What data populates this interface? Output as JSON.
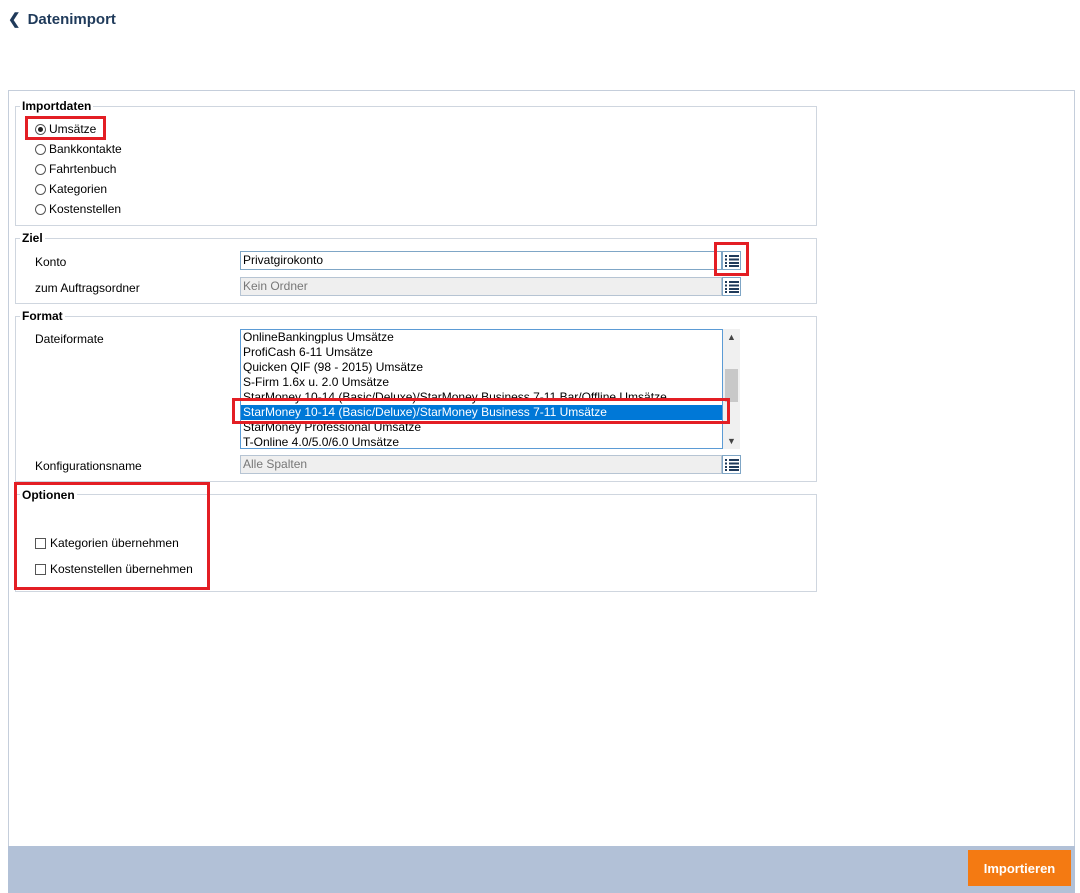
{
  "header": {
    "title": "Datenimport"
  },
  "importdaten": {
    "legend": "Importdaten",
    "options": [
      {
        "label": "Umsätze",
        "checked": true
      },
      {
        "label": "Bankkontakte",
        "checked": false
      },
      {
        "label": "Fahrtenbuch",
        "checked": false
      },
      {
        "label": "Kategorien",
        "checked": false
      },
      {
        "label": "Kostenstellen",
        "checked": false
      }
    ]
  },
  "ziel": {
    "legend": "Ziel",
    "konto_label": "Konto",
    "konto_value": "Privatgirokonto",
    "auftragsordner_label": "zum Auftragsordner",
    "auftragsordner_placeholder": "Kein Ordner"
  },
  "format": {
    "legend": "Format",
    "dateiformate_label": "Dateiformate",
    "items": [
      "OnlineBankingplus Umsätze",
      "ProfiCash 6-11 Umsätze",
      "Quicken QIF (98 - 2015) Umsätze",
      "S-Firm 1.6x u. 2.0 Umsätze",
      "StarMoney 10-14 (Basic/Deluxe)/StarMoney Business 7-11 Bar/Offline Umsätze",
      "StarMoney 10-14 (Basic/Deluxe)/StarMoney Business 7-11 Umsätze",
      "StarMoney Professional Umsätze",
      "T-Online 4.0/5.0/6.0 Umsätze"
    ],
    "selected_index": 5,
    "konfigurationsname_label": "Konfigurationsname",
    "konfigurationsname_placeholder": "Alle Spalten"
  },
  "optionen": {
    "legend": "Optionen",
    "checkboxes": [
      {
        "label": "Kategorien übernehmen",
        "checked": false
      },
      {
        "label": "Kostenstellen übernehmen",
        "checked": false
      }
    ]
  },
  "footer": {
    "import_button": "Importieren"
  },
  "colors": {
    "accent": "#f47a12",
    "footer_bg": "#b2c1d7",
    "selection": "#0078d7",
    "highlight": "#e31e24",
    "title": "#1f3a5a"
  }
}
